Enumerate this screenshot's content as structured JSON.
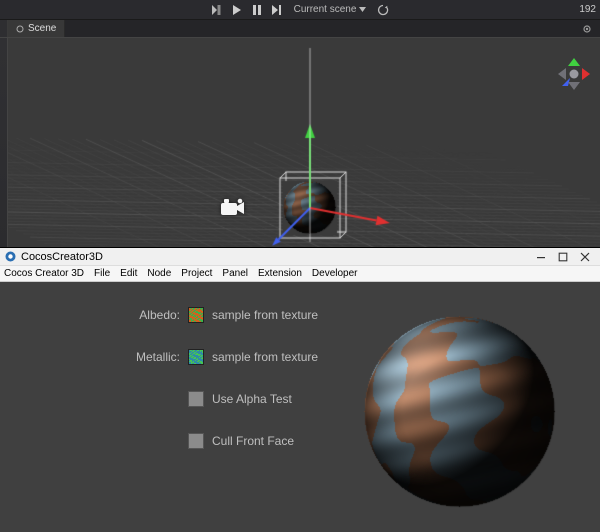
{
  "toolbar": {
    "scene_dropdown_label": "Current scene",
    "fps": "192"
  },
  "tabs": {
    "scene_label": "Scene"
  },
  "icons": {
    "camera": "camera"
  },
  "subwindow": {
    "title": "CocosCreator3D",
    "menu": [
      "Cocos Creator 3D",
      "File",
      "Edit",
      "Node",
      "Project",
      "Panel",
      "Extension",
      "Developer"
    ]
  },
  "inspector": {
    "albedo": {
      "label": "Albedo:",
      "value_label": "sample from texture"
    },
    "metallic": {
      "label": "Metallic:",
      "value_label": "sample from texture"
    },
    "alpha_test": {
      "label": "Use Alpha Test",
      "checked": false
    },
    "cull_front": {
      "label": "Cull Front Face",
      "checked": false
    }
  },
  "colors": {
    "axis_x": "#e03030",
    "axis_y": "#40d040",
    "axis_z": "#4060f0",
    "grid_major": "#555555",
    "grid_minor": "#454545",
    "viewport_bg": "#3a3a3a",
    "panel_bg": "#404040",
    "swatch_albedo_a": "#3ab24a",
    "swatch_albedo_b": "#d06020",
    "swatch_metallic_a": "#45c555",
    "swatch_metallic_b": "#2f8aa8",
    "sphere_land": "#b47a58",
    "sphere_sea": "#8aa9bb"
  }
}
